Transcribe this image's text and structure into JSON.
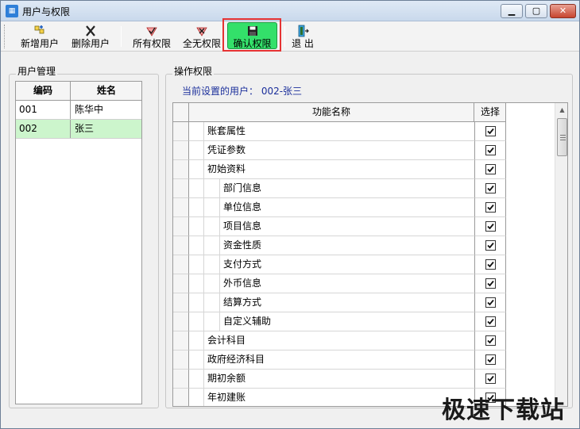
{
  "window": {
    "title": "用户与权限",
    "min_glyph": "▁",
    "max_glyph": "▢",
    "close_glyph": "✕"
  },
  "toolbar": {
    "add_user": "新增用户",
    "delete_user": "删除用户",
    "all_perms": "所有权限",
    "no_perms": "全无权限",
    "confirm_perms": "确认权限",
    "exit": "退 出",
    "confirm_bg": "#33e06a",
    "highlight_color": "#e53333"
  },
  "user_panel": {
    "title": "用户管理",
    "col_code": "编码",
    "col_name": "姓名",
    "rows": [
      {
        "code": "001",
        "name": "陈华中"
      },
      {
        "code": "002",
        "name": "张三"
      }
    ]
  },
  "perm_panel": {
    "title": "操作权限",
    "current_user_label": "当前设置的用户： 002-张三",
    "col_name": "功能名称",
    "col_select": "选择",
    "rows": [
      {
        "name": "账套属性",
        "level": 1,
        "checked": true
      },
      {
        "name": "凭证参数",
        "level": 1,
        "checked": true
      },
      {
        "name": "初始资料",
        "level": 1,
        "checked": true
      },
      {
        "name": "部门信息",
        "level": 2,
        "checked": true
      },
      {
        "name": "单位信息",
        "level": 2,
        "checked": true
      },
      {
        "name": "项目信息",
        "level": 2,
        "checked": true
      },
      {
        "name": "资金性质",
        "level": 2,
        "checked": true
      },
      {
        "name": "支付方式",
        "level": 2,
        "checked": true
      },
      {
        "name": "外币信息",
        "level": 2,
        "checked": true
      },
      {
        "name": "结算方式",
        "level": 2,
        "checked": true
      },
      {
        "name": "自定义辅助",
        "level": 2,
        "checked": true
      },
      {
        "name": "会计科目",
        "level": 1,
        "checked": true
      },
      {
        "name": "政府经济科目",
        "level": 1,
        "checked": true
      },
      {
        "name": "期初余额",
        "level": 1,
        "checked": true
      },
      {
        "name": "年初建账",
        "level": 1,
        "checked": true
      }
    ]
  },
  "watermark": "极速下载站"
}
